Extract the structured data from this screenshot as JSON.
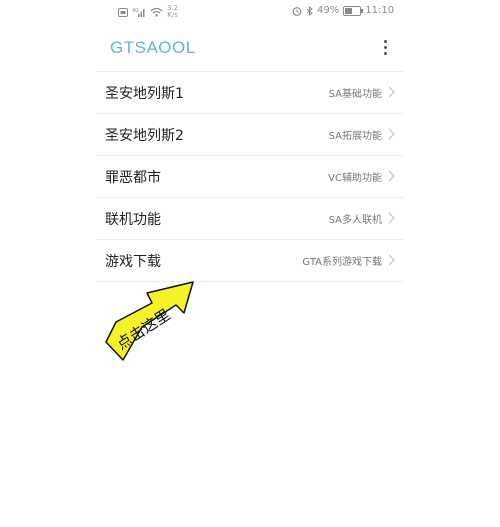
{
  "status_bar": {
    "network_speed": "3.2",
    "speed_unit": "K/s",
    "battery": "49%",
    "battery_level": 0.49,
    "time": "11:10"
  },
  "app_bar": {
    "title": "GTSAOOL"
  },
  "menu": [
    {
      "label": "圣安地列斯1",
      "desc": "SA基础功能"
    },
    {
      "label": "圣安地列斯2",
      "desc": "SA拓展功能"
    },
    {
      "label": "罪恶都市",
      "desc": "VC辅助功能"
    },
    {
      "label": "联机功能",
      "desc": "SA多人联机"
    },
    {
      "label": "游戏下载",
      "desc": "GTA系列游戏下载"
    }
  ],
  "annotation": {
    "text": "点击这里",
    "arrow_color": "#f5f227"
  }
}
